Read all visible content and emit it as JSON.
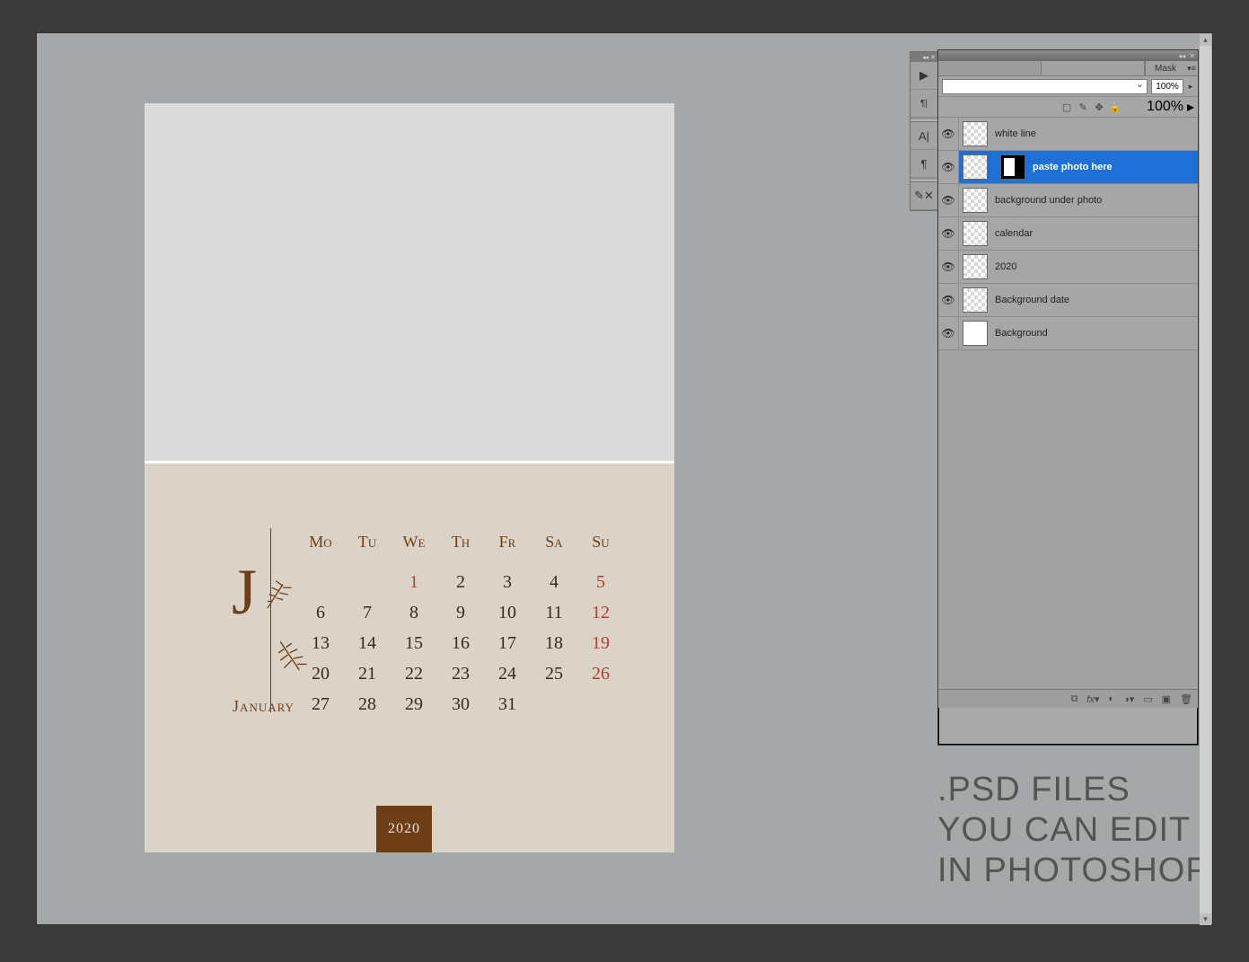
{
  "canvas": {
    "month_letter": "J",
    "month_name": "January",
    "year": "2020",
    "weekdays": [
      "Mo",
      "Tu",
      "We",
      "Th",
      "Fr",
      "Sa",
      "Su"
    ],
    "rows": [
      [
        "",
        "",
        "1",
        "2",
        "3",
        "4",
        "5"
      ],
      [
        "6",
        "7",
        "8",
        "9",
        "10",
        "11",
        "12"
      ],
      [
        "13",
        "14",
        "15",
        "16",
        "17",
        "18",
        "19"
      ],
      [
        "20",
        "21",
        "22",
        "23",
        "24",
        "25",
        "26"
      ],
      [
        "27",
        "28",
        "29",
        "30",
        "31",
        "",
        ""
      ]
    ],
    "red_cells": [
      "1",
      "5",
      "12",
      "19",
      "26"
    ]
  },
  "panel": {
    "mask_tab": "Mask",
    "opacity": "100%",
    "fill": "100%",
    "layers": [
      {
        "name": "white line",
        "selected": false,
        "mask": false,
        "solid": false
      },
      {
        "name": "paste photo here",
        "selected": true,
        "mask": true,
        "solid": false
      },
      {
        "name": "background under photo",
        "selected": false,
        "mask": false,
        "solid": false
      },
      {
        "name": "calendar",
        "selected": false,
        "mask": false,
        "solid": false
      },
      {
        "name": "2020",
        "selected": false,
        "mask": false,
        "solid": false
      },
      {
        "name": "Background date",
        "selected": false,
        "mask": false,
        "solid": false
      },
      {
        "name": "Background",
        "selected": false,
        "mask": false,
        "solid": true
      }
    ]
  },
  "promo": {
    "line1": ".PSD FILES",
    "line2": "YOU CAN EDIT",
    "line3": "IN PHOTOSHOP"
  }
}
